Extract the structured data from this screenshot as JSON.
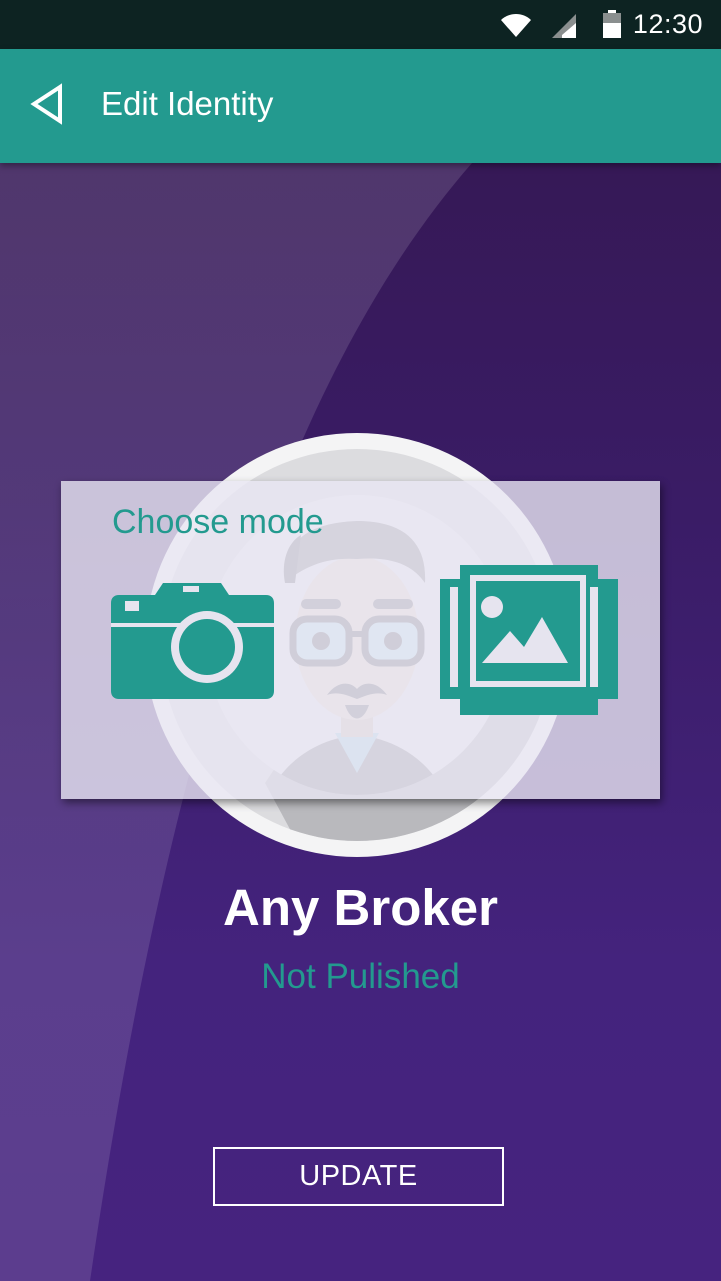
{
  "status_bar": {
    "time": "12:30",
    "icons": [
      "wifi-icon",
      "signal-icon",
      "battery-icon"
    ]
  },
  "app_bar": {
    "title": "Edit Identity",
    "back_icon": "back-triangle-icon"
  },
  "avatar": {
    "icon": "hipster-avatar"
  },
  "dialog": {
    "title": "Choose mode",
    "options": [
      {
        "name": "camera",
        "icon": "camera-icon"
      },
      {
        "name": "gallery",
        "icon": "gallery-icon"
      }
    ]
  },
  "identity": {
    "name": "Any Broker",
    "status": "Not Pulished"
  },
  "actions": {
    "update_label": "UPDATE"
  },
  "colors": {
    "accent": "#239a8f",
    "status_bar": "#0d2322",
    "background": "#3a1c66",
    "text_light": "#ffffff"
  }
}
